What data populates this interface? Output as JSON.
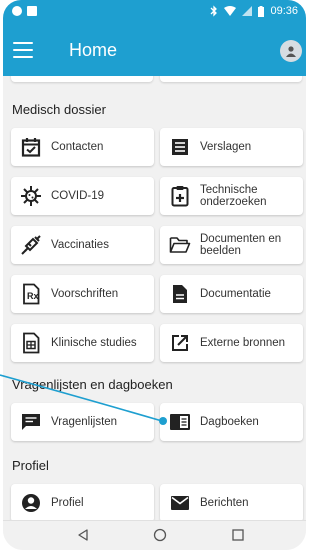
{
  "status_bar": {
    "time": "09:36"
  },
  "app_bar": {
    "title": "Home"
  },
  "sections": {
    "medisch": {
      "title": "Medisch dossier",
      "items": {
        "contacten": "Contacten",
        "verslagen": "Verslagen",
        "covid": "COVID-19",
        "technische": "Technische onderzoeken",
        "vaccinaties": "Vaccinaties",
        "documenten": "Documenten en beelden",
        "voorschriften": "Voorschriften",
        "documentatie": "Documentatie",
        "klinische": "Klinische studies",
        "externe": "Externe bronnen"
      }
    },
    "vragenlijsten": {
      "title": "Vragenlijsten en dagboeken",
      "items": {
        "vragenlijsten": "Vragenlijsten",
        "dagboeken": "Dagboeken"
      }
    },
    "profiel": {
      "title": "Profiel",
      "items": {
        "profiel": "Profiel",
        "berichten": "Berichten"
      }
    }
  },
  "colors": {
    "accent": "#1e9fd0",
    "icon": "#222222",
    "background": "#f1f1f1"
  },
  "icons": [
    "menu-icon",
    "account-icon",
    "calendar-check-icon",
    "list-icon",
    "virus-icon",
    "clipboard-plus-icon",
    "syringe-icon",
    "folder-icon",
    "prescription-icon",
    "file-text-icon",
    "file-table-icon",
    "external-link-icon",
    "chat-icon",
    "diary-icon",
    "person-circle-icon",
    "mail-icon",
    "back-icon",
    "home-icon",
    "recents-icon"
  ]
}
